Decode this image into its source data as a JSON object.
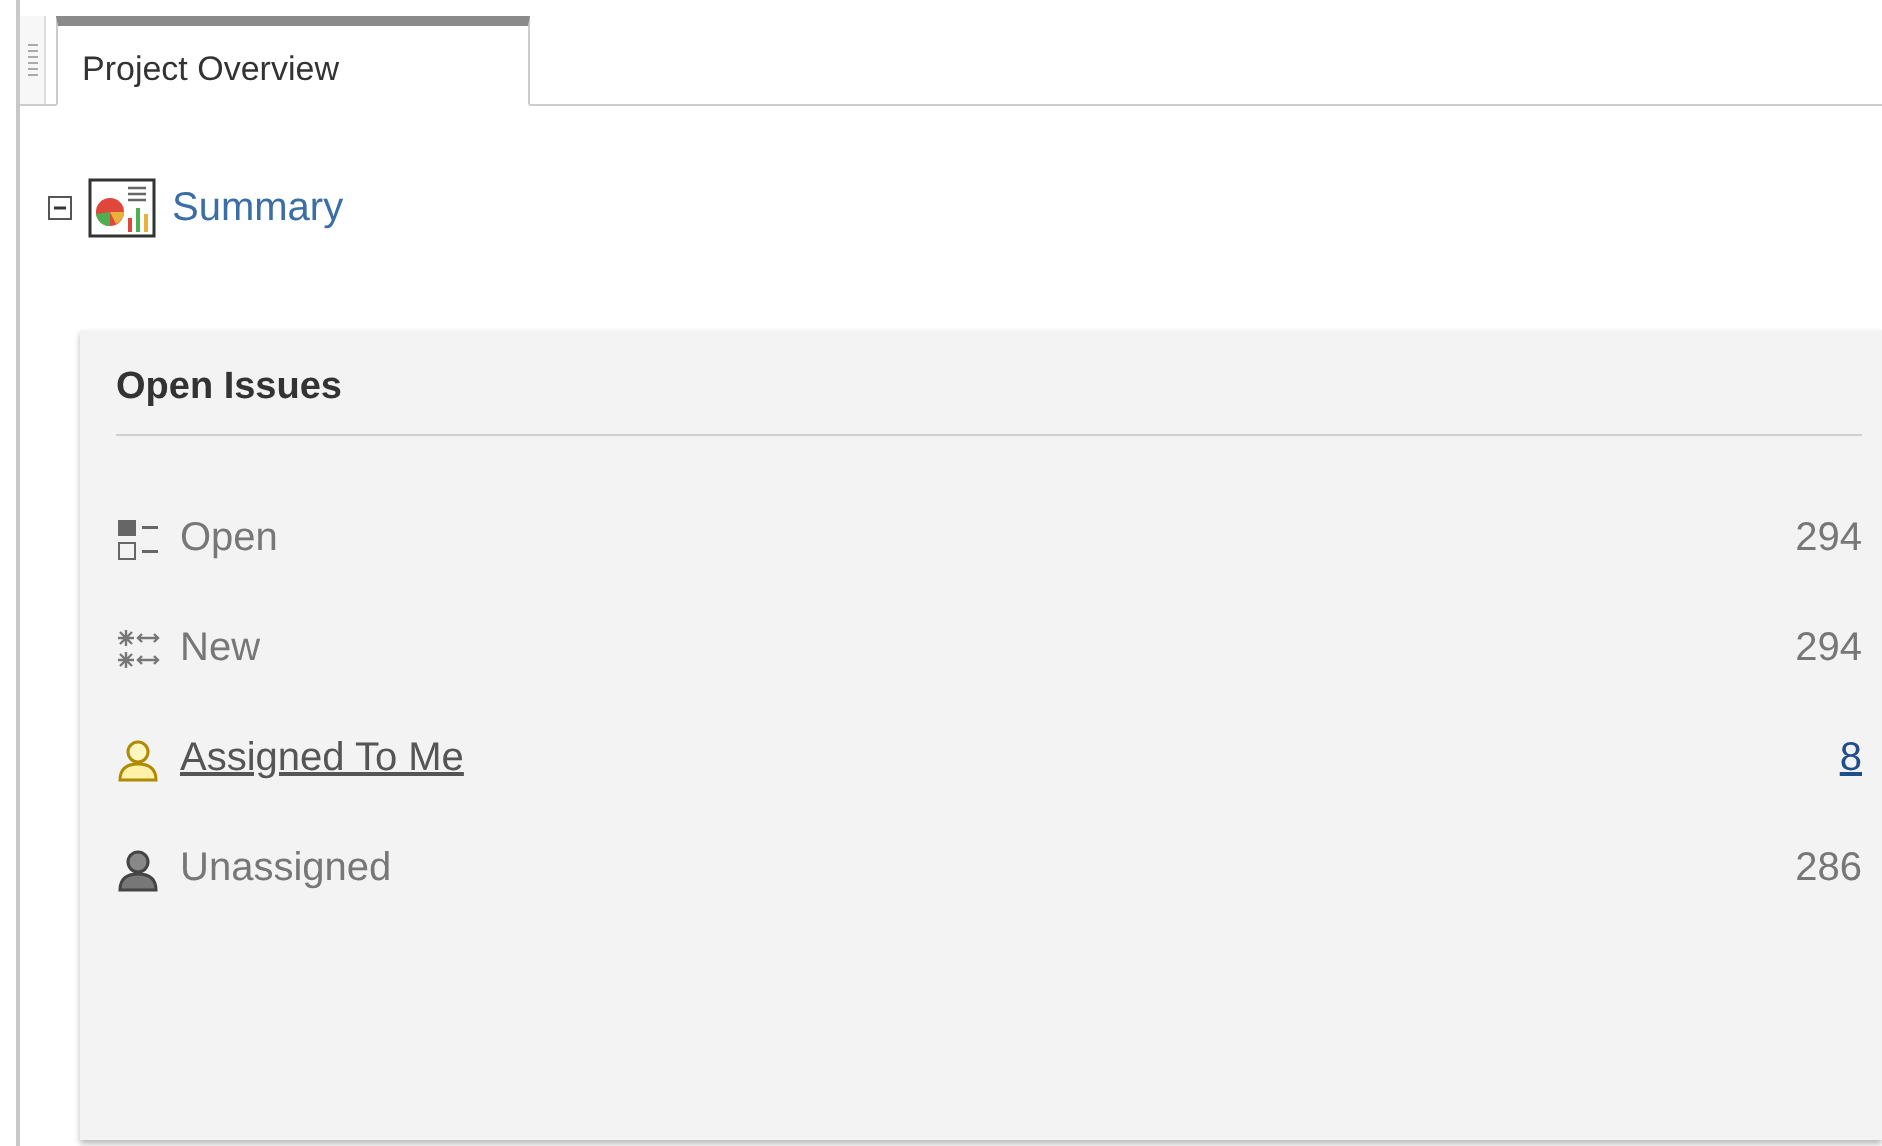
{
  "tabs": [
    {
      "label": "Project Overview",
      "selected": true
    }
  ],
  "tree": {
    "label": "Summary",
    "expanded": true
  },
  "panel": {
    "title": "Open Issues",
    "items": [
      {
        "kind": "open",
        "label": "Open",
        "count": "294",
        "link": false
      },
      {
        "kind": "new",
        "label": "New",
        "count": "294",
        "link": false
      },
      {
        "kind": "assigned",
        "label": "Assigned To Me",
        "count": "8",
        "link": true
      },
      {
        "kind": "unassigned",
        "label": "Unassigned",
        "count": "286",
        "link": false
      }
    ]
  }
}
